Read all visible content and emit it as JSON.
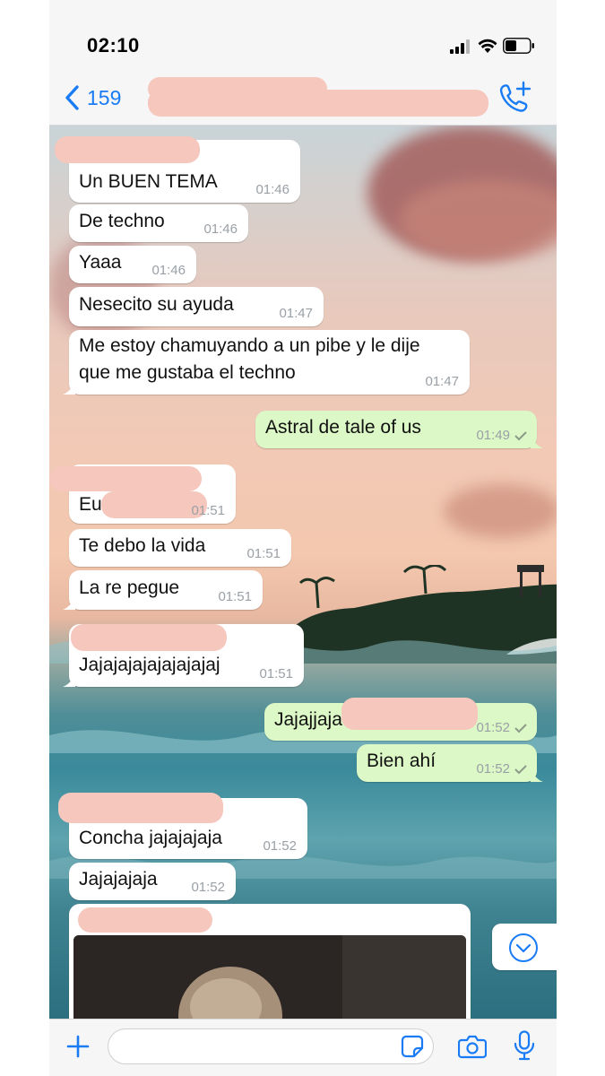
{
  "status_bar": {
    "time": "02:10"
  },
  "header": {
    "back_count": "159"
  },
  "messages": [
    {
      "text": "Un BUEN TEMA",
      "time": "01:46"
    },
    {
      "text": "De techno",
      "time": "01:46"
    },
    {
      "text": "Yaaa",
      "time": "01:46"
    },
    {
      "text": "Nesecito su ayuda",
      "time": "01:47"
    },
    {
      "text": "Me estoy chamuyando a un pibe y le dije\nque me gustaba el techno",
      "time": "01:47"
    },
    {
      "text": "Astral de tale of us",
      "time": "01:49"
    },
    {
      "text": "Eu",
      "time": "01:51"
    },
    {
      "text": "Te debo la vida",
      "time": "01:51"
    },
    {
      "text": "La re pegue",
      "time": "01:51"
    },
    {
      "text": "Jajajajajajajajajaj",
      "time": "01:51"
    },
    {
      "text": "Jajajjaja",
      "time": "01:52"
    },
    {
      "text": "Bien ahí",
      "time": "01:52"
    },
    {
      "text": "Concha jajajajaja",
      "time": "01:52"
    },
    {
      "text": "Jajajajaja",
      "time": "01:52"
    }
  ],
  "icons": {
    "back": "chevron-left-icon",
    "call": "phone-plus-icon",
    "plus": "plus-icon",
    "sticker": "sticker-icon",
    "camera": "camera-icon",
    "mic": "microphone-icon",
    "scroll": "chevron-down-icon",
    "read_receipt": "check-icon"
  },
  "colors": {
    "accent": "#1a7cf5",
    "outgoing_bubble": "#dcf8c6",
    "incoming_bubble": "#ffffff",
    "redaction": "#f6c7bd"
  }
}
